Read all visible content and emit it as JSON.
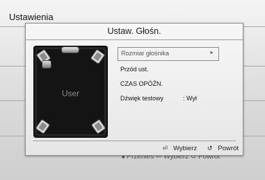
{
  "background": {
    "title": "Ustawienia",
    "footer": {
      "move_label": "Przenieś",
      "select_label": "Wybierz",
      "return_label": "Powrót"
    }
  },
  "dialog": {
    "title": "Ustaw. Głośn.",
    "preview_label": "User",
    "menu": [
      {
        "label": "Rozmiar głośnika",
        "selected": true
      },
      {
        "label": "Przód ust."
      },
      {
        "label": "CZAS OPÓŹN."
      },
      {
        "label": "Dźwięk testowy",
        "value": ":  Wył"
      }
    ],
    "footer": {
      "select_label": "Wybierz",
      "return_label": "Powrót"
    }
  },
  "icons": {
    "move": "move-arrows-icon",
    "select": "enter-icon",
    "return": "return-icon"
  }
}
